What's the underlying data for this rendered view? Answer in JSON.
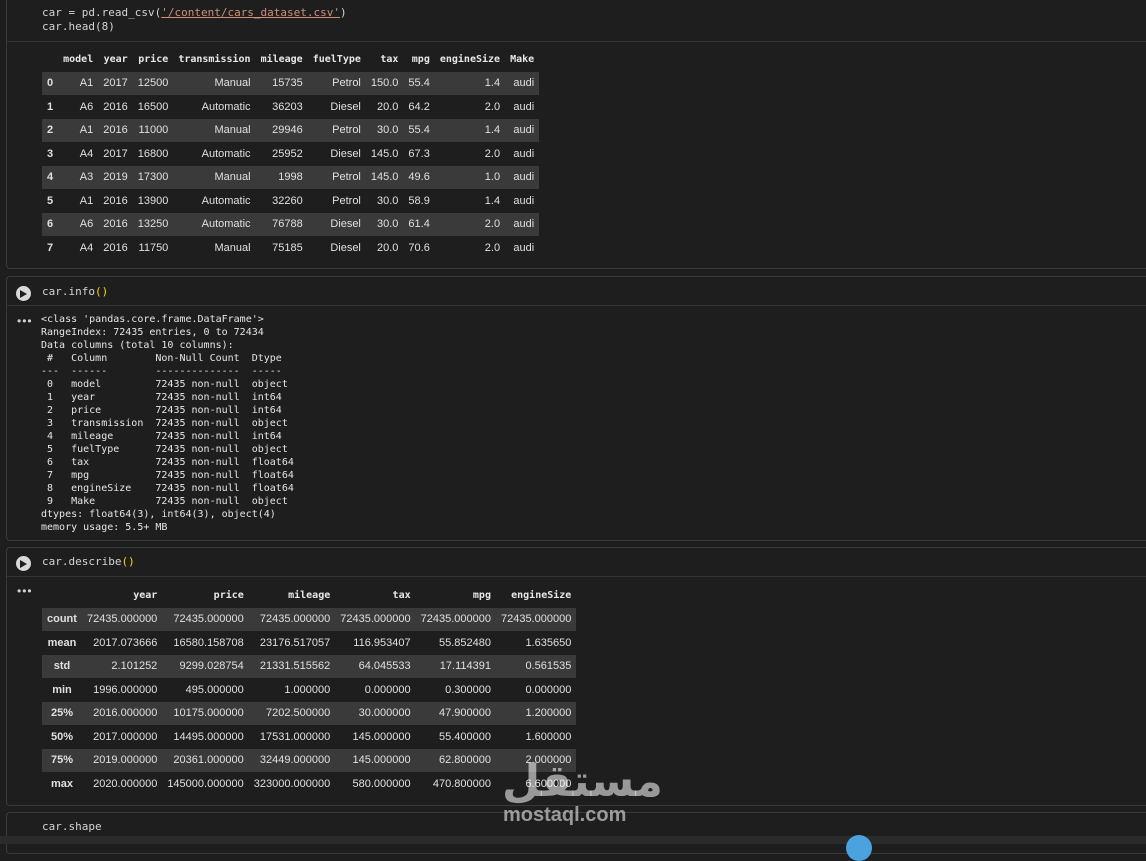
{
  "cell1": {
    "code": [
      "car = pd.read_csv(",
      "'/content/cars_dataset.csv'",
      ")",
      "car.head(8)"
    ],
    "headers": [
      "",
      "model",
      "year",
      "price",
      "transmission",
      "mileage",
      "fuelType",
      "tax",
      "mpg",
      "engineSize",
      "Make"
    ],
    "rows": [
      [
        "0",
        "A1",
        "2017",
        "12500",
        "Manual",
        "15735",
        "Petrol",
        "150.0",
        "55.4",
        "1.4",
        "audi"
      ],
      [
        "1",
        "A6",
        "2016",
        "16500",
        "Automatic",
        "36203",
        "Diesel",
        "20.0",
        "64.2",
        "2.0",
        "audi"
      ],
      [
        "2",
        "A1",
        "2016",
        "11000",
        "Manual",
        "29946",
        "Petrol",
        "30.0",
        "55.4",
        "1.4",
        "audi"
      ],
      [
        "3",
        "A4",
        "2017",
        "16800",
        "Automatic",
        "25952",
        "Diesel",
        "145.0",
        "67.3",
        "2.0",
        "audi"
      ],
      [
        "4",
        "A3",
        "2019",
        "17300",
        "Manual",
        "1998",
        "Petrol",
        "145.0",
        "49.6",
        "1.0",
        "audi"
      ],
      [
        "5",
        "A1",
        "2016",
        "13900",
        "Automatic",
        "32260",
        "Petrol",
        "30.0",
        "58.9",
        "1.4",
        "audi"
      ],
      [
        "6",
        "A6",
        "2016",
        "13250",
        "Automatic",
        "76788",
        "Diesel",
        "30.0",
        "61.4",
        "2.0",
        "audi"
      ],
      [
        "7",
        "A4",
        "2016",
        "11750",
        "Manual",
        "75185",
        "Diesel",
        "20.0",
        "70.6",
        "2.0",
        "audi"
      ]
    ]
  },
  "cell2": {
    "code": "car.info",
    "output": "<class 'pandas.core.frame.DataFrame'>\nRangeIndex: 72435 entries, 0 to 72434\nData columns (total 10 columns):\n #   Column        Non-Null Count  Dtype  \n---  ------        --------------  -----  \n 0   model         72435 non-null  object \n 1   year          72435 non-null  int64  \n 2   price         72435 non-null  int64  \n 3   transmission  72435 non-null  object \n 4   mileage       72435 non-null  int64  \n 5   fuelType      72435 non-null  object \n 6   tax           72435 non-null  float64\n 7   mpg           72435 non-null  float64\n 8   engineSize    72435 non-null  float64\n 9   Make          72435 non-null  object \ndtypes: float64(3), int64(3), object(4)\nmemory usage: 5.5+ MB"
  },
  "cell3": {
    "code": "car.describe",
    "headers": [
      "",
      "year",
      "price",
      "mileage",
      "tax",
      "mpg",
      "engineSize"
    ],
    "rows": [
      [
        "count",
        "72435.000000",
        "72435.000000",
        "72435.000000",
        "72435.000000",
        "72435.000000",
        "72435.000000"
      ],
      [
        "mean",
        "2017.073666",
        "16580.158708",
        "23176.517057",
        "116.953407",
        "55.852480",
        "1.635650"
      ],
      [
        "std",
        "2.101252",
        "9299.028754",
        "21331.515562",
        "64.045533",
        "17.114391",
        "0.561535"
      ],
      [
        "min",
        "1996.000000",
        "495.000000",
        "1.000000",
        "0.000000",
        "0.300000",
        "0.000000"
      ],
      [
        "25%",
        "2016.000000",
        "10175.000000",
        "7202.500000",
        "30.000000",
        "47.900000",
        "1.200000"
      ],
      [
        "50%",
        "2017.000000",
        "14495.000000",
        "17531.000000",
        "145.000000",
        "55.400000",
        "1.600000"
      ],
      [
        "75%",
        "2019.000000",
        "20361.000000",
        "32449.000000",
        "145.000000",
        "62.800000",
        "2.000000"
      ],
      [
        "max",
        "2020.000000",
        "145000.000000",
        "323000.000000",
        "580.000000",
        "470.800000",
        "6.600000"
      ]
    ]
  },
  "cell4": {
    "code": "car.shape"
  },
  "ui": {
    "output_ellipsis": "•••",
    "paren_open": "(",
    "paren_close": ")",
    "call_parens": "()"
  },
  "watermark": {
    "arabic": "مستقل",
    "latin": "mostaql.com"
  }
}
